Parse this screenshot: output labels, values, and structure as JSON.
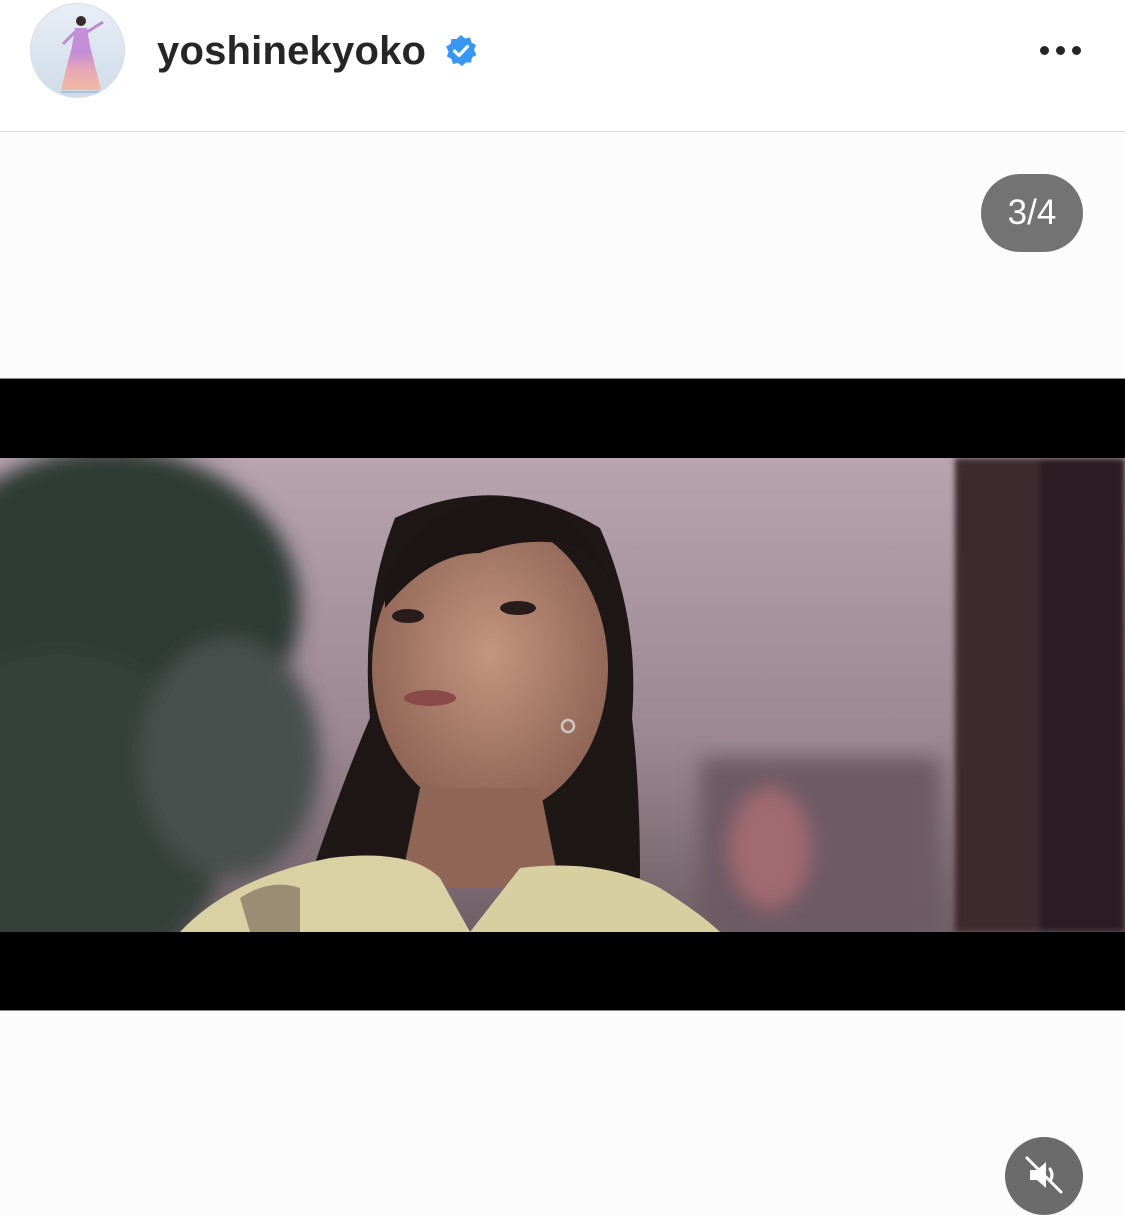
{
  "header": {
    "username": "yoshinekyoko",
    "verified_icon": "verified-badge-icon",
    "more_icon": "more-options-icon"
  },
  "post": {
    "carousel_counter": "3/4",
    "media_type": "video",
    "mute_icon": "speaker-muted-icon"
  },
  "colors": {
    "verified_blue": "#3897f0",
    "text_primary": "#262626"
  }
}
